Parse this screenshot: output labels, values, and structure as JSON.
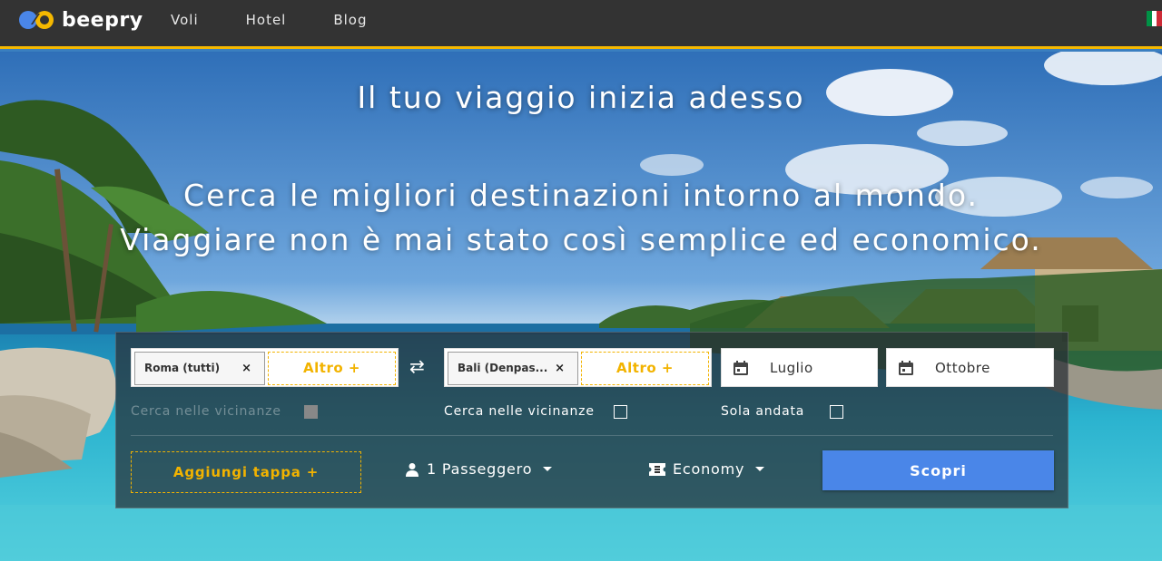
{
  "header": {
    "brand": "beepry",
    "nav": [
      "Voli",
      "Hotel",
      "Blog"
    ],
    "brand_colors": {
      "bar": "#333333",
      "accent": "#f5b800",
      "logo_blue": "#4a86e8",
      "logo_yellow": "#f5b800"
    }
  },
  "hero": {
    "headline": "Il tuo viaggio inizia adesso",
    "subline_1": "Cerca le migliori destinazioni intorno al mondo.",
    "subline_2": "Viaggiare non è mai stato così semplice ed economico."
  },
  "search": {
    "origin": {
      "chip": "Roma (tutti)",
      "remove": "×",
      "more": "Altro +"
    },
    "destination": {
      "chip": "Bali (Denpas...",
      "remove": "×",
      "more": "Altro +"
    },
    "swap_icon": "⇄",
    "depart": {
      "icon": "calendar-icon",
      "label": "Luglio"
    },
    "return": {
      "icon": "calendar-icon",
      "label": "Ottobre"
    },
    "origin_nearby": {
      "label": "Cerca nelle vicinanze",
      "checked": false,
      "disabled": true
    },
    "destination_nearby": {
      "label": "Cerca nelle vicinanze",
      "checked": false
    },
    "one_way": {
      "label": "Sola andata",
      "checked": false
    },
    "add_stop": "Aggiungi tappa +",
    "passengers": {
      "icon": "person-icon",
      "label": "1 Passeggero"
    },
    "cabin": {
      "icon": "ticket-icon",
      "label": "Economy"
    },
    "submit": "Scopri",
    "accent_color": "#4a86e8",
    "dashed_color": "#f2b300"
  },
  "locale_flag": [
    "#009246",
    "#ffffff",
    "#ce2b37"
  ]
}
